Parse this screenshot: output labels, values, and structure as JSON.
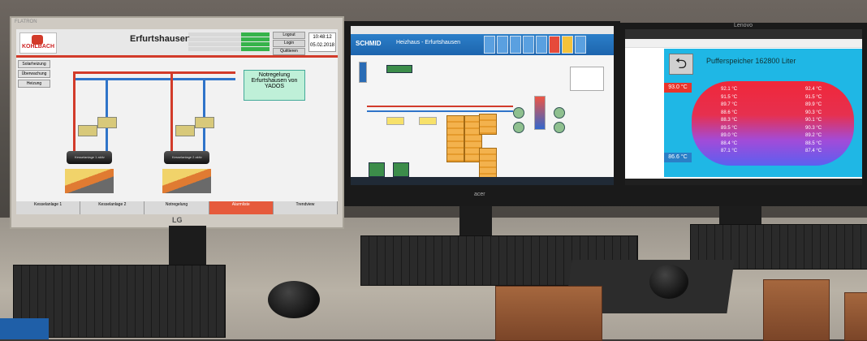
{
  "scene": {
    "colors": {
      "accent_red": "#d23b2a",
      "scada_blue": "#1d64ad",
      "tank_hot": "#f0273a",
      "tank_cold": "#5c5ff0",
      "panel_cyan": "#1fb7e5"
    }
  },
  "monitor_left": {
    "bezel_brand": "FLATRON",
    "brand_logo": "LG",
    "logo_text": "KOHLBACH",
    "title": "Erfurtshausen",
    "notice": "Notregelung Erfurtshausen von YADOS",
    "header_buttons": [
      "Logout",
      "Login",
      "Quittieren"
    ],
    "date": "05.02.2018",
    "time": "10:48:12",
    "side_buttons": [
      "Solarheizung",
      "Überwachung",
      "Heizung"
    ],
    "boiler_labels": [
      "Kesselanlage 1 aktiv",
      "Kesselanlage 2 aktiv"
    ],
    "bottom_tabs": [
      "Kesselanlage 1",
      "Kesselanlage 2",
      "Notregelung",
      "Alarmliste",
      "Trendview"
    ],
    "active_tab_index": 3
  },
  "monitor_center": {
    "brand_logo": "acer",
    "logo_text": "SCHMID",
    "title": "Heizhaus - Erfurtshausen",
    "icon_names": [
      "home-icon",
      "plant-icon",
      "chart-icon",
      "trend-icon",
      "list-icon",
      "alarm-icon",
      "warning-icon",
      "settings-icon"
    ]
  },
  "monitor_right": {
    "brand_logo": "Lenovo",
    "title": "Pufferspeicher 162800 Liter",
    "back_icon": "back-arrow-icon",
    "temp_top": "93.0 °C",
    "temp_bottom": "86.6 °C",
    "left_column": [
      "92.1 °C",
      "91.5 °C",
      "89.7 °C",
      "88.6 °C",
      "88.3 °C",
      "89.5 °C",
      "89.0 °C",
      "88.4 °C",
      "87.1 °C"
    ],
    "right_column": [
      "92.4 °C",
      "91.5 °C",
      "89.9 °C",
      "90.3 °C",
      "90.1 °C",
      "90.3 °C",
      "89.2 °C",
      "88.5 °C",
      "87.4 °C"
    ]
  }
}
